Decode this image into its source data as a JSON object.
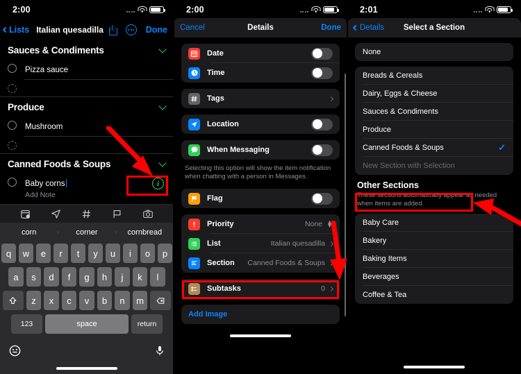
{
  "panel1": {
    "status": {
      "time": "2:00",
      "wifi": "wifi-icon",
      "battery": "battery-icon"
    },
    "nav": {
      "back_label": "Lists",
      "title": "Italian quesadilla",
      "share": "share-icon",
      "more": "more-circle-icon",
      "done_label": "Done"
    },
    "sections": [
      {
        "title": "Sauces & Condiments",
        "items": [
          {
            "label": "Pizza sauce",
            "note": "",
            "dashed": false,
            "editing": false
          },
          {
            "label": "",
            "note": "",
            "dashed": true,
            "editing": false
          }
        ]
      },
      {
        "title": "Produce",
        "items": [
          {
            "label": "Mushroom",
            "note": "",
            "dashed": false,
            "editing": false
          },
          {
            "label": "",
            "note": "",
            "dashed": true,
            "editing": false
          }
        ]
      },
      {
        "title": "Canned Foods & Soups",
        "items": [
          {
            "label": "Baby corns",
            "note": "Add Note",
            "dashed": false,
            "editing": true
          }
        ]
      }
    ],
    "info_icon": "info-circle-icon",
    "keyboard": {
      "toolbar_icons": [
        "calendar-icon",
        "location-arrow-icon",
        "hashtag-icon",
        "flag-icon",
        "camera-icon"
      ],
      "suggestions": [
        "corn",
        "corner",
        "cornbread"
      ],
      "row1": [
        "q",
        "w",
        "e",
        "r",
        "t",
        "y",
        "u",
        "i",
        "o",
        "p"
      ],
      "row2": [
        "a",
        "s",
        "d",
        "f",
        "g",
        "h",
        "j",
        "k",
        "l"
      ],
      "row3": [
        "z",
        "x",
        "c",
        "v",
        "b",
        "n",
        "m"
      ],
      "shift": "shift-icon",
      "backspace": "backspace-icon",
      "numbers_label": "123",
      "space_label": "space",
      "return_label": "return",
      "emoji": "emoji-icon",
      "mic": "microphone-icon"
    }
  },
  "panel2": {
    "status": {
      "time": "2:00"
    },
    "nav": {
      "cancel_label": "Cancel",
      "title": "Details",
      "done_label": "Done"
    },
    "groups": [
      {
        "rows": [
          {
            "icon": "calendar-icon",
            "color": "#ff3b30",
            "label": "Date",
            "control": "toggle"
          },
          {
            "icon": "clock-icon",
            "color": "#0a84ff",
            "label": "Time",
            "control": "toggle"
          }
        ]
      },
      {
        "rows": [
          {
            "icon": "hashtag-icon",
            "color": "#636366",
            "label": "Tags",
            "control": "chevron"
          }
        ]
      },
      {
        "rows": [
          {
            "icon": "location-arrow-icon",
            "color": "#0a84ff",
            "label": "Location",
            "control": "toggle"
          }
        ]
      },
      {
        "rows": [
          {
            "icon": "message-icon",
            "color": "#30d158",
            "label": "When Messaging",
            "control": "toggle"
          }
        ]
      }
    ],
    "footnote": "Selecting this option will show the item notification when chatting with a person in Messages.",
    "flag_group": {
      "rows": [
        {
          "icon": "flag-icon",
          "color": "#ff9f0a",
          "label": "Flag",
          "control": "toggle"
        }
      ]
    },
    "detail_group": {
      "rows": [
        {
          "icon": "exclamation-icon",
          "color": "#ff3b30",
          "label": "Priority",
          "value": "None",
          "control": "stepper"
        },
        {
          "icon": "list-icon",
          "color": "#30d158",
          "label": "List",
          "value": "Italian quesadilla",
          "control": "chevron"
        },
        {
          "icon": "section-icon",
          "color": "#0a84ff",
          "label": "Section",
          "value": "Canned Foods & Soups",
          "control": "chevron"
        }
      ]
    },
    "subtasks_group": {
      "rows": [
        {
          "icon": "subtasks-icon",
          "color": "#b08d57",
          "label": "Subtasks",
          "value": "0",
          "control": "chevron"
        }
      ]
    },
    "add_image_label": "Add Image"
  },
  "panel3": {
    "status": {
      "time": "2:01"
    },
    "nav": {
      "back_label": "Details",
      "title": "Select a Section"
    },
    "none_label": "None",
    "sections": [
      {
        "label": "Breads & Cereals",
        "selected": false,
        "disabled": false
      },
      {
        "label": "Dairy, Eggs & Cheese",
        "selected": false,
        "disabled": false
      },
      {
        "label": "Sauces & Condiments",
        "selected": false,
        "disabled": false
      },
      {
        "label": "Produce",
        "selected": false,
        "disabled": false
      },
      {
        "label": "Canned Foods & Soups",
        "selected": true,
        "disabled": false
      },
      {
        "label": "New Section with Selection",
        "selected": false,
        "disabled": true
      }
    ],
    "other_title": "Other Sections",
    "other_subtitle": "These sections automatically appear as needed when items are added.",
    "other_sections": [
      {
        "label": "Baby Care"
      },
      {
        "label": "Bakery"
      },
      {
        "label": "Baking Items"
      },
      {
        "label": "Beverages"
      },
      {
        "label": "Coffee & Tea"
      }
    ]
  },
  "annotations": {
    "highlight_color": "#fe0000"
  }
}
